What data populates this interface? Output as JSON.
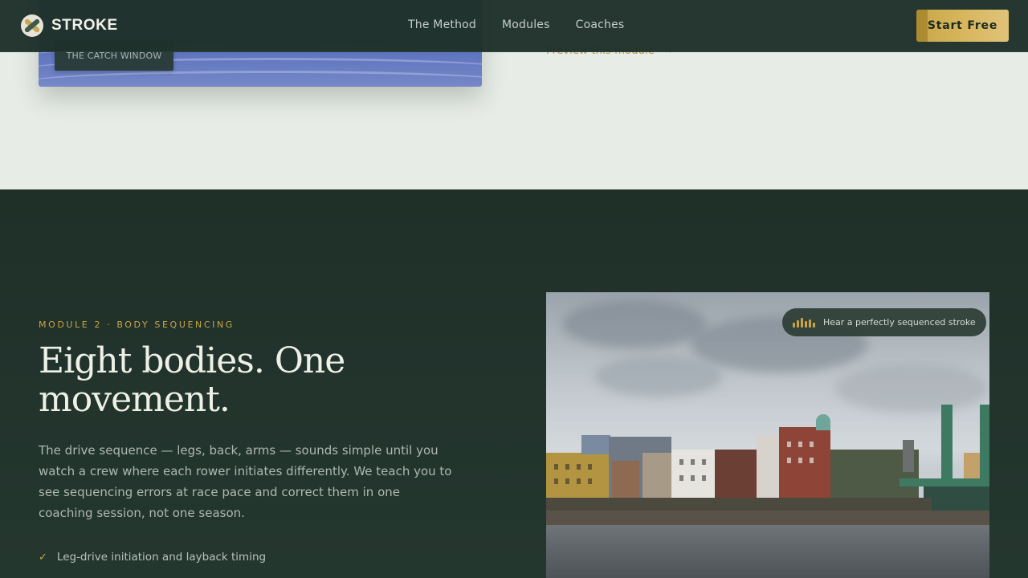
{
  "brand": {
    "name": "STROKE",
    "logo_icon": "oars-crest-icon"
  },
  "nav": {
    "links": [
      "The Method",
      "Modules",
      "Coaches"
    ],
    "cta_label": "Start Free"
  },
  "top_section": {
    "card_tag": "THE CATCH WINDOW",
    "preview_link": "Preview this module",
    "preview_arrow": "→"
  },
  "module": {
    "eyebrow": "MODULE 2 · BODY SEQUENCING",
    "headline_line1": "Eight bodies. One",
    "headline_line2": "movement.",
    "body": "The drive sequence — legs, back, arms — sounds simple until you watch a crew where each rower initiates differently. We teach you to see sequencing errors at race pace and correct them in one coaching session, not one season.",
    "checklist": [
      "Leg-drive initiation and layback timing"
    ],
    "audio_label": "Hear a perfectly sequenced stroke"
  },
  "colors": {
    "nav_bg": "#1f312a",
    "accent_gold": "#c9a447",
    "section_dark": "#1f3029",
    "section_light": "#e8ece7"
  }
}
